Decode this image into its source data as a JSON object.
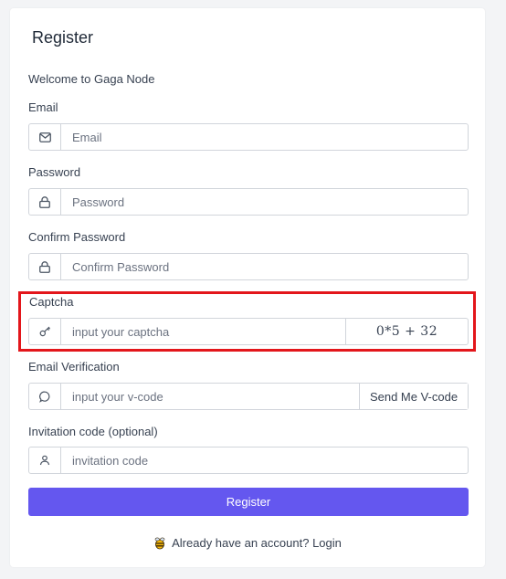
{
  "form": {
    "title": "Register",
    "welcome": "Welcome to Gaga Node"
  },
  "fields": {
    "email": {
      "label": "Email",
      "placeholder": "Email",
      "icon": "mail-icon"
    },
    "password": {
      "label": "Password",
      "placeholder": "Password",
      "icon": "lock-icon"
    },
    "confirm_password": {
      "label": "Confirm Password",
      "placeholder": "Confirm Password",
      "icon": "lock-icon"
    },
    "captcha": {
      "label": "Captcha",
      "placeholder": "input your captcha",
      "icon": "key-icon",
      "challenge": "0*5 + 32"
    },
    "email_verification": {
      "label": "Email Verification",
      "placeholder": "input your v-code",
      "icon": "chat-bubble-icon",
      "button": "Send Me V-code"
    },
    "invitation": {
      "label": "Invitation code (optional)",
      "placeholder": "invitation code",
      "icon": "user-icon"
    }
  },
  "register_button": "Register",
  "footer": {
    "prefix": "Already have an account?",
    "login": "Login",
    "icon": "bee-icon"
  },
  "colors": {
    "primary": "#6457ef",
    "highlight": "#e3161b",
    "background": "#f3f4f6"
  }
}
